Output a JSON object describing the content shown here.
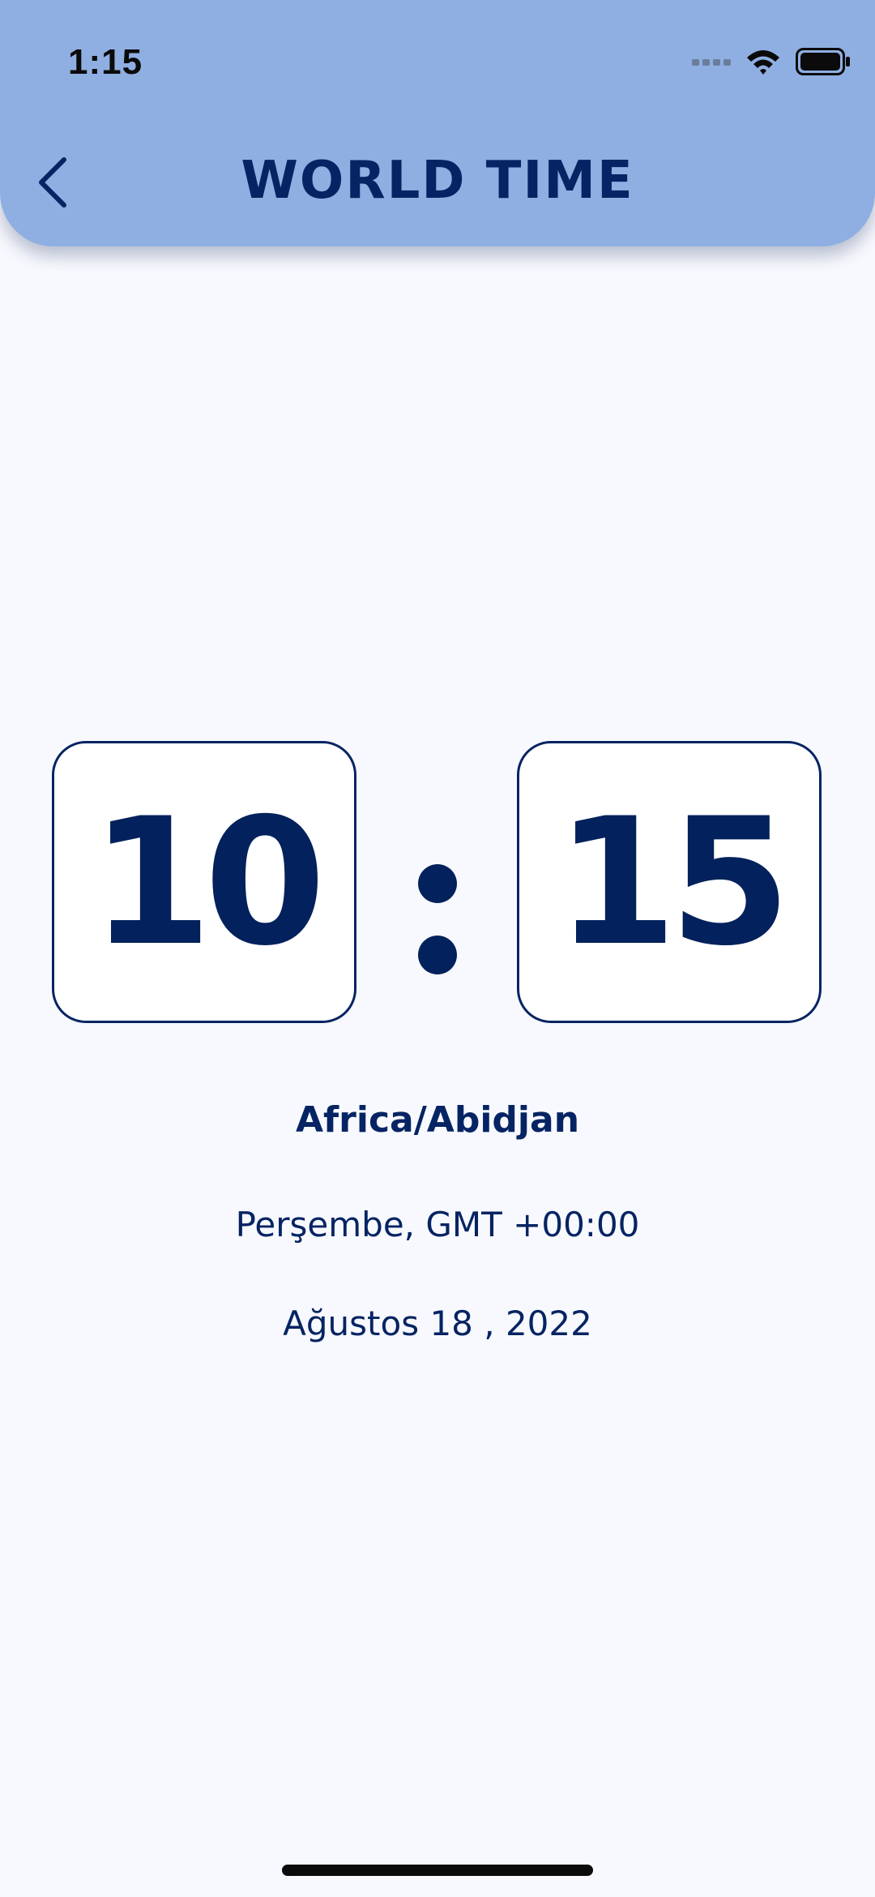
{
  "status_bar": {
    "time": "1:15",
    "icons": [
      "signal-icon",
      "wifi-icon",
      "battery-icon"
    ]
  },
  "header": {
    "back_icon": "chevron-left-icon",
    "title": "WORLD TIME"
  },
  "clock": {
    "hours": "10",
    "minutes": "15"
  },
  "location": {
    "city": "Africa/Abidjan",
    "day_offset": "Perşembe, GMT +00:00",
    "date": "Ağustos 18 , 2022"
  },
  "colors": {
    "header_background": "#8fafe2",
    "page_background": "#f8f9fe",
    "text_primary": "#062463"
  }
}
